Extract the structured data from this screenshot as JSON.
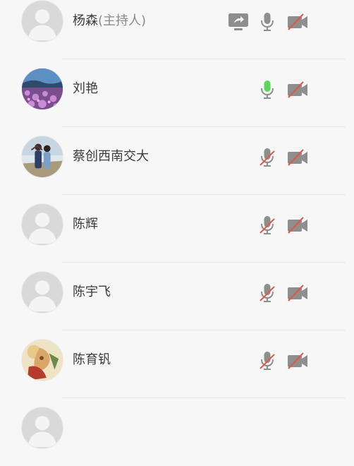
{
  "participants": [
    {
      "name": "杨森",
      "host_label": "(主持人)",
      "avatar": "placeholder",
      "sharing": true,
      "mic": "on",
      "camera": "off"
    },
    {
      "name": "刘艳",
      "host_label": "",
      "avatar": "photo-flowers",
      "sharing": false,
      "mic": "speaking",
      "camera": "off"
    },
    {
      "name": "蔡创西南交大",
      "host_label": "",
      "avatar": "photo-couple",
      "sharing": false,
      "mic": "muted",
      "camera": "off"
    },
    {
      "name": "陈辉",
      "host_label": "",
      "avatar": "placeholder",
      "sharing": false,
      "mic": "muted",
      "camera": "off"
    },
    {
      "name": "陈宇飞",
      "host_label": "",
      "avatar": "placeholder",
      "sharing": false,
      "mic": "muted",
      "camera": "off"
    },
    {
      "name": "陈育钒",
      "host_label": "",
      "avatar": "photo-painting",
      "sharing": false,
      "mic": "muted",
      "camera": "off"
    },
    {
      "name": "",
      "host_label": "",
      "avatar": "placeholder",
      "sharing": false,
      "mic": "",
      "camera": ""
    }
  ],
  "colors": {
    "background": "#f7f7f7",
    "icon_gray": "#8e8e8e",
    "speaking_green": "#5bd65b",
    "muted_red": "#e2574c",
    "divider": "#e6e6e6"
  },
  "icons": {
    "share": "screen-share-icon",
    "mic": "microphone-icon",
    "mic_muted": "microphone-muted-icon",
    "camera_off": "camera-off-icon"
  }
}
